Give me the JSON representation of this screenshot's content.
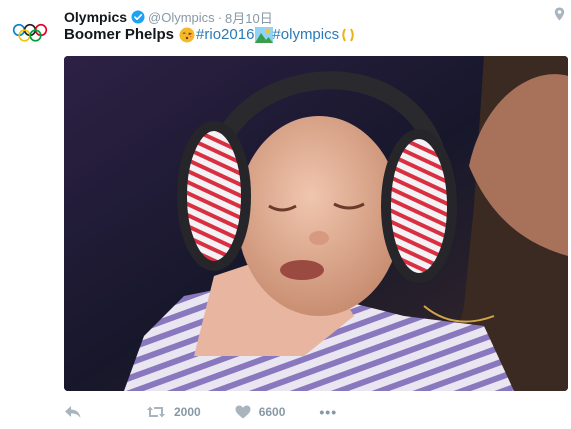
{
  "tweet": {
    "author_name": "Olympics",
    "handle": "@Olympics",
    "separator": "·",
    "timestamp": "8月10日",
    "text_bold": "Boomer Phelps",
    "hashtag_rio": "#rio2016",
    "hashtag_olympics": "#olympics"
  },
  "actions": {
    "retweet_count": "2000",
    "like_count": "6600",
    "more_label": "•••"
  },
  "colors": {
    "link": "#2b7bb9",
    "verified": "#1da1f2",
    "muted": "#8899a6"
  },
  "icons": [
    "olympic-rings-icon",
    "verified-badge-icon",
    "location-pin-icon",
    "kissing-face-emoji-icon",
    "landscape-emoji-icon",
    "laurel-emoji-icon",
    "reply-icon",
    "retweet-icon",
    "heart-icon",
    "more-icon"
  ]
}
